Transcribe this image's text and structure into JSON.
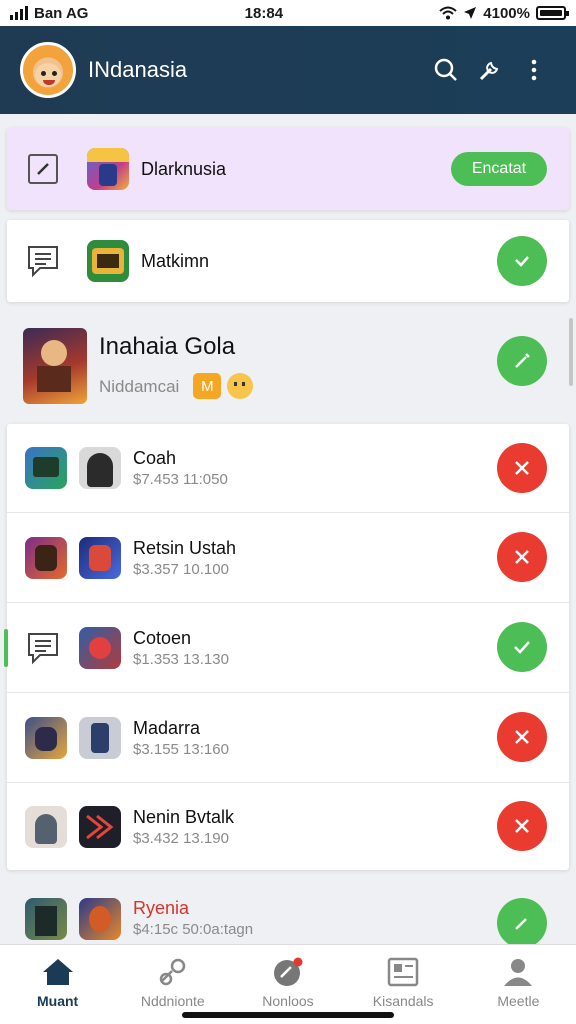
{
  "status_bar": {
    "carrier": "Ban AG",
    "time": "18:84",
    "battery": "4100%"
  },
  "header": {
    "title": "INdanasia",
    "icons": [
      "search-icon",
      "tools-icon",
      "more-icon"
    ]
  },
  "rows": [
    {
      "name": "Dlarknusia",
      "button": "Encatat",
      "highlight": "#f0e3fb"
    },
    {
      "name": "Matkimn"
    },
    {
      "name": "Inahaia Gola",
      "subtitle": "Niddamcai",
      "badge": "M"
    },
    {
      "name": "Coah",
      "sub": "$7.453 11:050",
      "status": "remove"
    },
    {
      "name": "Retsin Ustah",
      "sub": "$3.357 10.100",
      "status": "remove"
    },
    {
      "name": "Cotoen",
      "sub": "$1.353 13.130",
      "status": "accept"
    },
    {
      "name": "Madarra",
      "sub": "$3.155 13:160",
      "status": "remove"
    },
    {
      "name": "Nenin Bvtalk",
      "sub": "$3.432 13.190",
      "status": "remove"
    },
    {
      "name": "Ryenia",
      "sub": "$4:15c 50:0a:tagn",
      "status": "edit"
    }
  ],
  "nav": [
    {
      "label": "Muant",
      "icon": "home-icon",
      "active": true
    },
    {
      "label": "Nddnionte",
      "icon": "link-icon"
    },
    {
      "label": "Nonloos",
      "icon": "notification-icon"
    },
    {
      "label": "Kisandals",
      "icon": "gallery-icon"
    },
    {
      "label": "Meetle",
      "icon": "profile-icon"
    }
  ],
  "colors": {
    "header": "#1f3b54",
    "accent_green": "#4dbe55",
    "danger_red": "#ea3b30",
    "highlight_purple": "#f0e3fb"
  }
}
